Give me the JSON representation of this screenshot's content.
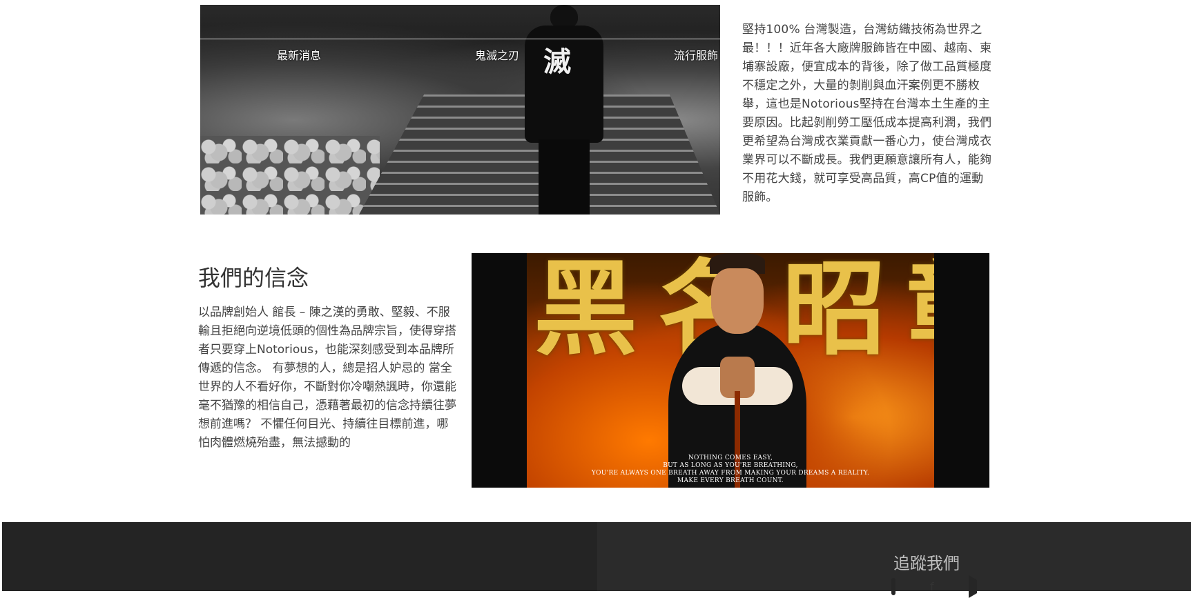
{
  "nav": {
    "news": "最新消息",
    "kimetsu": "鬼滅之刃",
    "fashion": "流行服飾"
  },
  "hero": {
    "shirt_kanji": "滅"
  },
  "about": {
    "paragraph": "堅持100% 台灣製造，台灣紡織技術為世界之最！！！近年各大廠牌服飾皆在中國、越南、柬埔寨設廠，便宜成本的背後，除了做工品質極度不穩定之外，大量的剝削與血汗案例更不勝枚舉，這也是Notorious堅持在台灣本土生產的主要原因。比起剝削勞工壓低成本提高利潤，我們更希望為台灣成衣業貢獻一番心力，使台灣成衣業界可以不斷成長。我們更願意讓所有人，能夠不用花大錢，就可享受高品質，高CP值的運動服飾。"
  },
  "belief": {
    "title": "我們的信念",
    "paragraph": "以品牌創始人 館長 – 陳之漢的勇敢、堅毅、不服輸且拒絕向逆境低頭的個性為品牌宗旨，使得穿搭者只要穿上Notorious，也能深刻感受到本品牌所傳遞的信念。 有夢想的人，總是招人妒忌的 當全世界的人不看好你，不斷對你冷嘲熱諷時，你還能毫不猶豫的相信自己，憑藉著最初的信念持續往夢想前進嗎？ 不懼任何目光、持續往目標前進，哪怕肉體燃燒殆盡，無法撼動的"
  },
  "poster": {
    "headline": "黑名昭彰",
    "quote_lines": [
      "NOTHING COMES EASY,",
      "BUT AS LONG AS YOU'RE BREATHING,",
      "YOU'RE ALWAYS ONE BREATH AWAY FROM MAKING YOUR DREAMS A REALITY.",
      "MAKE EVERY BREATH COUNT."
    ]
  },
  "footer": {
    "follow_title": "追蹤我們",
    "social": [
      "instagram-icon",
      "facebook-icon",
      "youtube-icon"
    ],
    "fb_glyph": "f"
  },
  "colors": {
    "footer_bg": "#262626",
    "social_accent": "#e7b10a"
  }
}
